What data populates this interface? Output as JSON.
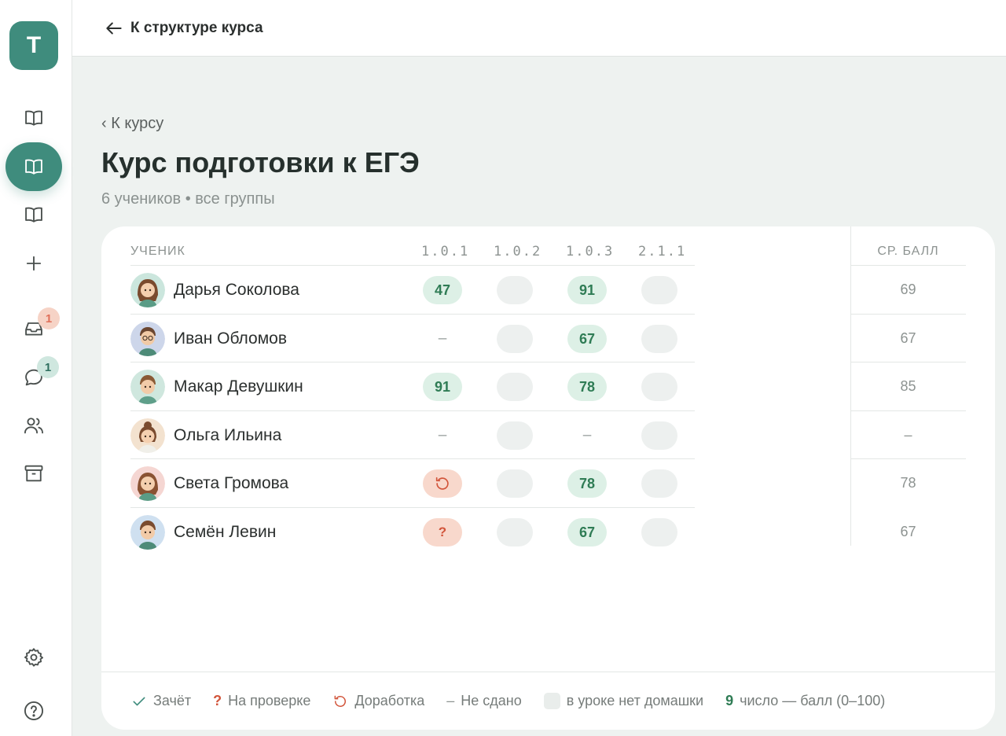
{
  "sidebar": {
    "logo_letter": "T",
    "inbox_badge": "1",
    "chat_badge": "1"
  },
  "topbar": {
    "back_label": "К структуре курса"
  },
  "page": {
    "back_link": "‹ К курсу",
    "title": "Курс подготовки к ЕГЭ",
    "subtitle": "6 учеников • все группы"
  },
  "table": {
    "student_header": "УЧЕНИК",
    "lesson_headers": [
      "1.0.1",
      "1.0.2",
      "1.0.3",
      "2.1.1"
    ],
    "avg_header": "СР. БАЛЛ",
    "rows": [
      {
        "name": "Дарья Соколова",
        "cells": [
          "47",
          "",
          "91",
          ""
        ],
        "avg": "69"
      },
      {
        "name": "Иван Обломов",
        "cells": [
          "–",
          "",
          "67",
          ""
        ],
        "avg": "67"
      },
      {
        "name": "Макар Девушкин",
        "cells": [
          "91",
          "",
          "78",
          ""
        ],
        "avg": "85"
      },
      {
        "name": "Ольга Ильина",
        "cells": [
          "–",
          "",
          "–",
          ""
        ],
        "avg": "–"
      },
      {
        "name": "Света Громова",
        "cells": [
          "↻",
          "",
          "78",
          ""
        ],
        "avg": "78"
      },
      {
        "name": "Семён Левин",
        "cells": [
          "?",
          "",
          "67",
          ""
        ],
        "avg": "67"
      }
    ]
  },
  "legend": {
    "pass": "Зачёт",
    "review_mark": "?",
    "review": "На проверке",
    "rework": "Доработка",
    "dash_mark": "–",
    "not_submitted": "Не сдано",
    "no_homework": "в уроке нет домашки",
    "number_mark": "9",
    "number": "число — балл (0–100)"
  },
  "colors": {
    "accent": "#3f8c7d",
    "grade_bg": "#ddf0e6",
    "grade_text": "#2f7c55",
    "alert_bg": "#f8d8cc",
    "alert_text": "#d2553b"
  }
}
